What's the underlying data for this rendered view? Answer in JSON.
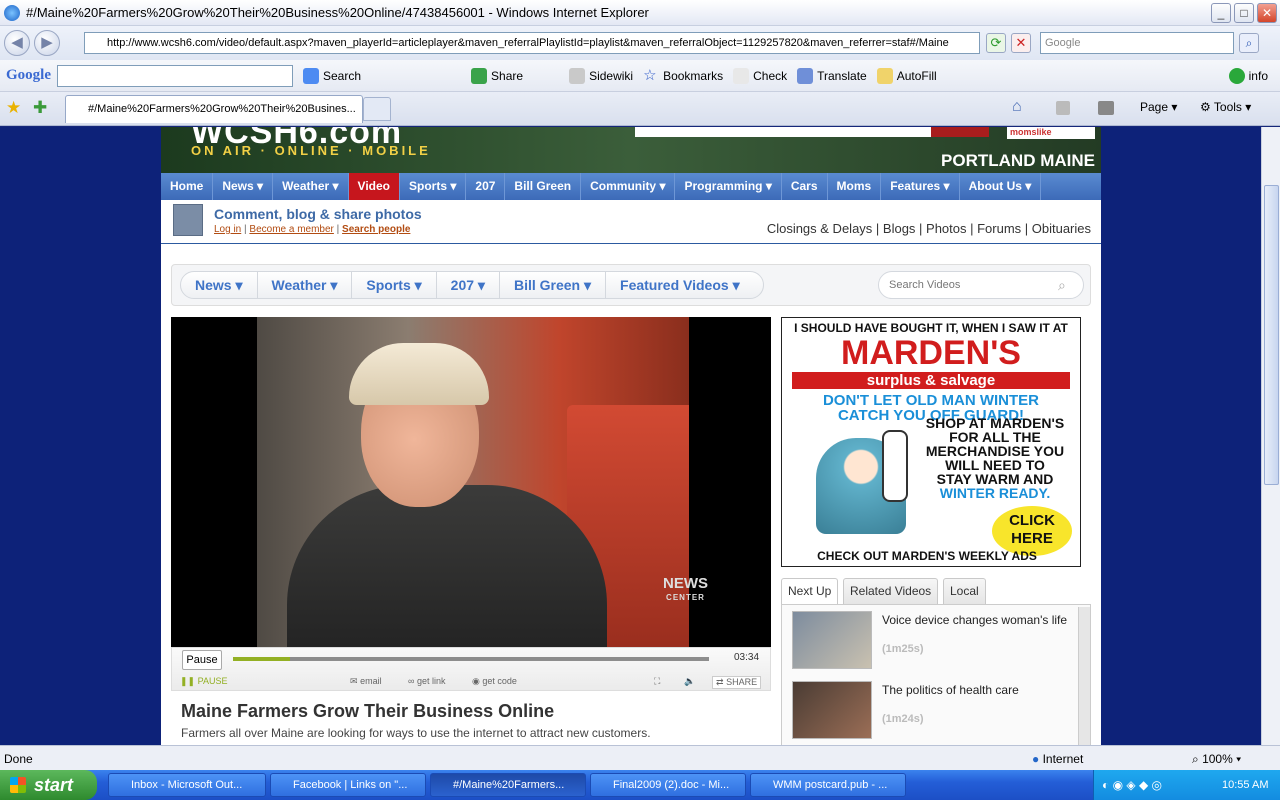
{
  "window": {
    "title": "#/Maine%20Farmers%20Grow%20Their%20Business%20Online/47438456001 - Windows Internet Explorer",
    "minimize": "_",
    "maximize": "□",
    "close": "✕"
  },
  "address_bar": {
    "url": "http://www.wcsh6.com/video/default.aspx?maven_playerId=articleplayer&maven_referralPlaylistId=playlist&maven_referralObject=1129257820&maven_referrer=staf#/Maine",
    "search_placeholder": "Google"
  },
  "google_toolbar": {
    "logo": "Google",
    "items": [
      "Search",
      "Share",
      "Sidewiki",
      "Bookmarks",
      "Check",
      "Translate",
      "AutoFill",
      "info"
    ]
  },
  "tabs": {
    "active_tab": "#/Maine%20Farmers%20Grow%20Their%20Busines..."
  },
  "command_bar": {
    "page": "Page",
    "tools": "Tools"
  },
  "site": {
    "logo": "WCSH6.com",
    "tagline": "ON AIR · ONLINE · MOBILE",
    "location": "PORTLAND MAINE",
    "nav": [
      "Home",
      "News ▾",
      "Weather ▾",
      "Video",
      "Sports ▾",
      "207",
      "Bill Green",
      "Community ▾",
      "Programming ▾",
      "Cars",
      "Moms",
      "Features ▾",
      "About Us ▾"
    ],
    "community": {
      "heading": "Comment, blog & share photos",
      "login": "Log in",
      "become_member": "Become a member",
      "search_people": "Search people",
      "right_links": "Closings & Delays | Blogs | Photos | Forums | Obituaries"
    },
    "video_nav": [
      "News ▾",
      "Weather ▾",
      "Sports ▾",
      "207 ▾",
      "Bill Green ▾",
      "Featured Videos ▾"
    ],
    "search_videos_placeholder": "Search Videos"
  },
  "player": {
    "pause_button": "Pause",
    "state": "PAUSE",
    "duration": "03:34",
    "progress": 0.12,
    "email": "email",
    "get_link": "get link",
    "get_code": "get code",
    "share": "SHARE",
    "news_bug": "NEWS",
    "news_bug_sub": "CENTER"
  },
  "video": {
    "title": "Maine Farmers Grow Their Business Online",
    "description": "Farmers all over Maine are looking for ways to use the internet to attract new customers."
  },
  "ad": {
    "line1": "I SHOULD HAVE BOUGHT IT, WHEN I SAW IT AT",
    "brand": "MARDEN'S",
    "sub": "surplus & salvage",
    "line2": "DON'T LET OLD MAN WINTER",
    "line3": "CATCH YOU OFF GUARD!",
    "body1": "SHOP AT MARDEN'S",
    "body2": "FOR ALL THE",
    "body3": "MERCHANDISE YOU",
    "body4": "WILL NEED TO",
    "body5": "STAY WARM AND",
    "body6": "WINTER READY.",
    "click": "CLICK HERE",
    "footer": "CHECK OUT MARDEN'S WEEKLY ADS"
  },
  "next_up": {
    "tabs": [
      "Next Up",
      "Related Videos",
      "Local"
    ],
    "items": [
      {
        "title": "Voice device changes woman's life",
        "duration": "(1m25s)"
      },
      {
        "title": "The politics of health care",
        "duration": "(1m24s)"
      }
    ]
  },
  "status_bar": {
    "left": "Done",
    "zone": "Internet",
    "zoom": "100%"
  },
  "taskbar": {
    "start": "start",
    "items": [
      "Inbox - Microsoft Out...",
      "Facebook | Links on \"...",
      "#/Maine%20Farmers...",
      "Final2009 (2).doc - Mi...",
      "WMM postcard.pub - ..."
    ],
    "clock": "10:55 AM"
  },
  "colors": {
    "page_bg": "#15277a",
    "nav_blue": "#3c6ab8",
    "video_tab_red": "#c6161d",
    "progress_green": "#93b024"
  }
}
